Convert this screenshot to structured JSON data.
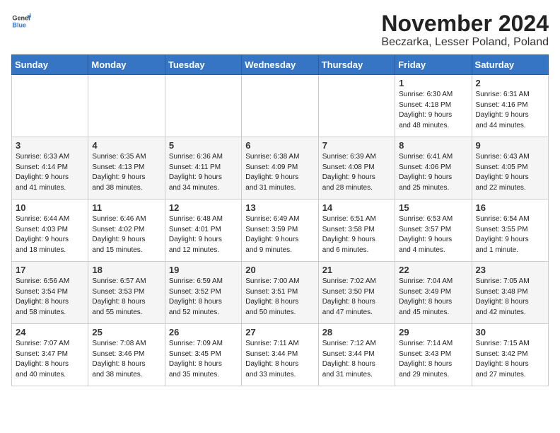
{
  "header": {
    "logo_general": "General",
    "logo_blue": "Blue",
    "month_title": "November 2024",
    "location": "Beczarka, Lesser Poland, Poland"
  },
  "weekdays": [
    "Sunday",
    "Monday",
    "Tuesday",
    "Wednesday",
    "Thursday",
    "Friday",
    "Saturday"
  ],
  "weeks": [
    [
      {
        "day": "",
        "info": ""
      },
      {
        "day": "",
        "info": ""
      },
      {
        "day": "",
        "info": ""
      },
      {
        "day": "",
        "info": ""
      },
      {
        "day": "",
        "info": ""
      },
      {
        "day": "1",
        "info": "Sunrise: 6:30 AM\nSunset: 4:18 PM\nDaylight: 9 hours\nand 48 minutes."
      },
      {
        "day": "2",
        "info": "Sunrise: 6:31 AM\nSunset: 4:16 PM\nDaylight: 9 hours\nand 44 minutes."
      }
    ],
    [
      {
        "day": "3",
        "info": "Sunrise: 6:33 AM\nSunset: 4:14 PM\nDaylight: 9 hours\nand 41 minutes."
      },
      {
        "day": "4",
        "info": "Sunrise: 6:35 AM\nSunset: 4:13 PM\nDaylight: 9 hours\nand 38 minutes."
      },
      {
        "day": "5",
        "info": "Sunrise: 6:36 AM\nSunset: 4:11 PM\nDaylight: 9 hours\nand 34 minutes."
      },
      {
        "day": "6",
        "info": "Sunrise: 6:38 AM\nSunset: 4:09 PM\nDaylight: 9 hours\nand 31 minutes."
      },
      {
        "day": "7",
        "info": "Sunrise: 6:39 AM\nSunset: 4:08 PM\nDaylight: 9 hours\nand 28 minutes."
      },
      {
        "day": "8",
        "info": "Sunrise: 6:41 AM\nSunset: 4:06 PM\nDaylight: 9 hours\nand 25 minutes."
      },
      {
        "day": "9",
        "info": "Sunrise: 6:43 AM\nSunset: 4:05 PM\nDaylight: 9 hours\nand 22 minutes."
      }
    ],
    [
      {
        "day": "10",
        "info": "Sunrise: 6:44 AM\nSunset: 4:03 PM\nDaylight: 9 hours\nand 18 minutes."
      },
      {
        "day": "11",
        "info": "Sunrise: 6:46 AM\nSunset: 4:02 PM\nDaylight: 9 hours\nand 15 minutes."
      },
      {
        "day": "12",
        "info": "Sunrise: 6:48 AM\nSunset: 4:01 PM\nDaylight: 9 hours\nand 12 minutes."
      },
      {
        "day": "13",
        "info": "Sunrise: 6:49 AM\nSunset: 3:59 PM\nDaylight: 9 hours\nand 9 minutes."
      },
      {
        "day": "14",
        "info": "Sunrise: 6:51 AM\nSunset: 3:58 PM\nDaylight: 9 hours\nand 6 minutes."
      },
      {
        "day": "15",
        "info": "Sunrise: 6:53 AM\nSunset: 3:57 PM\nDaylight: 9 hours\nand 4 minutes."
      },
      {
        "day": "16",
        "info": "Sunrise: 6:54 AM\nSunset: 3:55 PM\nDaylight: 9 hours\nand 1 minute."
      }
    ],
    [
      {
        "day": "17",
        "info": "Sunrise: 6:56 AM\nSunset: 3:54 PM\nDaylight: 8 hours\nand 58 minutes."
      },
      {
        "day": "18",
        "info": "Sunrise: 6:57 AM\nSunset: 3:53 PM\nDaylight: 8 hours\nand 55 minutes."
      },
      {
        "day": "19",
        "info": "Sunrise: 6:59 AM\nSunset: 3:52 PM\nDaylight: 8 hours\nand 52 minutes."
      },
      {
        "day": "20",
        "info": "Sunrise: 7:00 AM\nSunset: 3:51 PM\nDaylight: 8 hours\nand 50 minutes."
      },
      {
        "day": "21",
        "info": "Sunrise: 7:02 AM\nSunset: 3:50 PM\nDaylight: 8 hours\nand 47 minutes."
      },
      {
        "day": "22",
        "info": "Sunrise: 7:04 AM\nSunset: 3:49 PM\nDaylight: 8 hours\nand 45 minutes."
      },
      {
        "day": "23",
        "info": "Sunrise: 7:05 AM\nSunset: 3:48 PM\nDaylight: 8 hours\nand 42 minutes."
      }
    ],
    [
      {
        "day": "24",
        "info": "Sunrise: 7:07 AM\nSunset: 3:47 PM\nDaylight: 8 hours\nand 40 minutes."
      },
      {
        "day": "25",
        "info": "Sunrise: 7:08 AM\nSunset: 3:46 PM\nDaylight: 8 hours\nand 38 minutes."
      },
      {
        "day": "26",
        "info": "Sunrise: 7:09 AM\nSunset: 3:45 PM\nDaylight: 8 hours\nand 35 minutes."
      },
      {
        "day": "27",
        "info": "Sunrise: 7:11 AM\nSunset: 3:44 PM\nDaylight: 8 hours\nand 33 minutes."
      },
      {
        "day": "28",
        "info": "Sunrise: 7:12 AM\nSunset: 3:44 PM\nDaylight: 8 hours\nand 31 minutes."
      },
      {
        "day": "29",
        "info": "Sunrise: 7:14 AM\nSunset: 3:43 PM\nDaylight: 8 hours\nand 29 minutes."
      },
      {
        "day": "30",
        "info": "Sunrise: 7:15 AM\nSunset: 3:42 PM\nDaylight: 8 hours\nand 27 minutes."
      }
    ]
  ]
}
